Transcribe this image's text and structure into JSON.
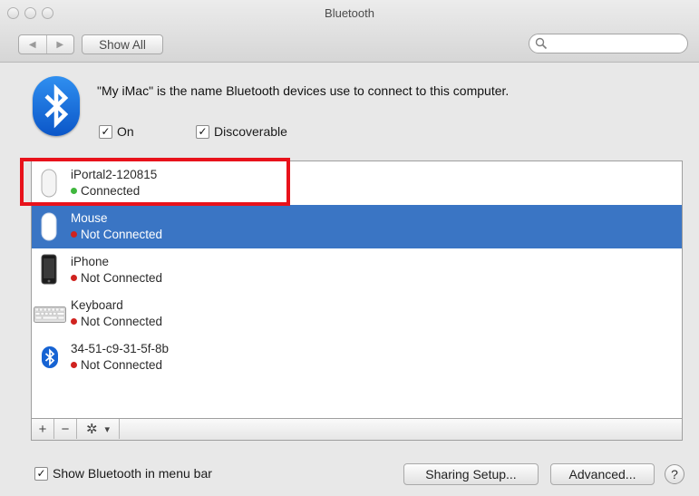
{
  "window": {
    "title": "Bluetooth"
  },
  "toolbar": {
    "back_glyph": "◀",
    "forward_glyph": "▶",
    "show_all_label": "Show All",
    "search_placeholder": ""
  },
  "header": {
    "description": "\"My iMac\" is the name Bluetooth devices use to connect to this computer.",
    "on_label": "On",
    "on_checked": true,
    "discoverable_label": "Discoverable",
    "discoverable_checked": true
  },
  "devices": [
    {
      "name": "iPortal2-120815",
      "status": "Connected",
      "status_color": "#3fb73d",
      "icon": "mouse-icon",
      "selected": false
    },
    {
      "name": "Mouse",
      "status": "Not Connected",
      "status_color": "#d0231f",
      "icon": "mouse-icon",
      "selected": true
    },
    {
      "name": "iPhone",
      "status": "Not Connected",
      "status_color": "#d0231f",
      "icon": "iphone-icon",
      "selected": false
    },
    {
      "name": "Keyboard",
      "status": "Not Connected",
      "status_color": "#d0231f",
      "icon": "keyboard-icon",
      "selected": false
    },
    {
      "name": "34-51-c9-31-5f-8b",
      "status": "Not Connected",
      "status_color": "#d0231f",
      "icon": "bluetooth-icon",
      "selected": false
    }
  ],
  "list_toolbar": {
    "add": "+",
    "remove": "−",
    "gear_glyph": "✲",
    "menu_glyph": "▾"
  },
  "footer": {
    "show_in_menu_bar_label": "Show Bluetooth in menu bar",
    "show_in_menu_bar_checked": true,
    "sharing_setup_label": "Sharing Setup...",
    "advanced_label": "Advanced...",
    "help_label": "?"
  },
  "colors": {
    "selection": "#3a75c4",
    "highlight_box": "#e8121b",
    "bluetooth_blue": "#0b56c8"
  }
}
